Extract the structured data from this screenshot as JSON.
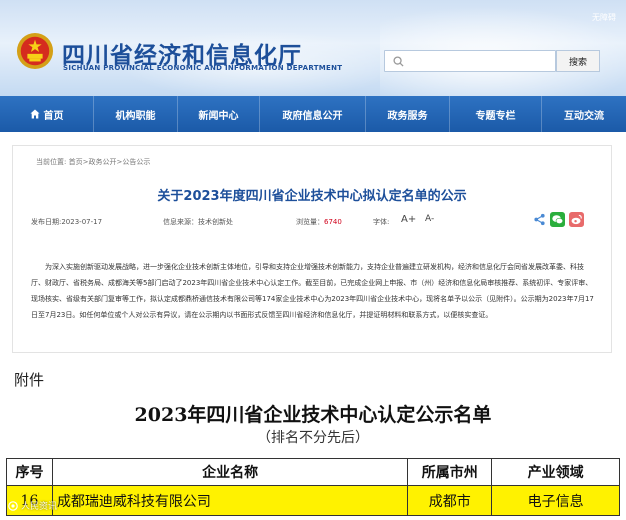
{
  "header": {
    "title": "四川省经济和信息化厅",
    "subtitle": "SICHUAN PROVINCIAL ECONOMIC AND INFORMATION DEPARTMENT",
    "top_link": "无障碍",
    "search_placeholder": "",
    "search_button": "搜索",
    "colors": {
      "title": "#1d4f9a",
      "nav": "#2466b6"
    }
  },
  "nav": {
    "items": [
      {
        "label": "首页",
        "icon": "home-icon"
      },
      {
        "label": "机构职能"
      },
      {
        "label": "新闻中心"
      },
      {
        "label": "政府信息公开"
      },
      {
        "label": "政务服务"
      },
      {
        "label": "专题专栏"
      },
      {
        "label": "互动交流"
      }
    ]
  },
  "article": {
    "breadcrumb": "当前位置: 首页>政务公开>公告公示",
    "title": "关于2023年度四川省企业技术中心拟认定名单的公示",
    "date": "发布日期:2023-07-17",
    "source": "信息来源：技术创新处",
    "views_label": "浏览量：",
    "views": "6740",
    "font_label": "字体:",
    "font_big": "A+",
    "font_small": "A-",
    "share_icons": [
      "share-icon",
      "wechat-icon",
      "weibo-icon"
    ],
    "body": "为深入实施创新驱动发展战略，进一步强化企业技术创新主体地位，引导和支持企业增强技术创新能力，支持企业普遍建立研发机构，经济和信息化厅会同省发展改革委、科技厅、财政厅、省税务局、成都海关等5部门启动了2023年四川省企业技术中心认定工作。截至目前，已完成企业网上申报、市（州）经济和信息化局审核推荐、系统初评、专家评审、现场核实、省级有关部门复审等工作，拟认定成都鼎桥通信技术有限公司等174家企业技术中心为2023年四川省企业技术中心，现将名单予以公示（见附件）。公示期为2023年7月17日至7月23日。如任何单位或个人对公示有异议，请在公示期内以书面形式反馈至四川省经济和信息化厅，并提证明材料和联系方式，以便核实查证。"
  },
  "attachment": {
    "label": "附件",
    "list_title": "2023年四川省企业技术中心认定公示名单",
    "list_subtitle": "（排名不分先后）",
    "table": {
      "headers": [
        "序号",
        "企业名称",
        "所属市州",
        "产业领域"
      ],
      "rows": [
        {
          "seq": "16",
          "name": "成都瑞迪威科技有限公司",
          "city": "成都市",
          "field": "电子信息"
        }
      ],
      "highlight_color": "#fff200"
    }
  },
  "watermark": "人民资讯"
}
